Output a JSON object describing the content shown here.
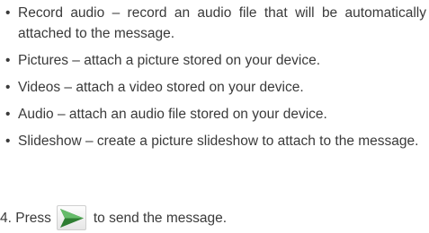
{
  "bullet_symbol": "•",
  "bullets": [
    {
      "text": "Record audio – record an audio file that will be automatically attached to the message."
    },
    {
      "text": "Pictures – attach a picture stored on your device."
    },
    {
      "text": "Videos – attach a video stored on your device."
    },
    {
      "text": "Audio – attach an audio file stored on your device."
    },
    {
      "text": "Slideshow – create a picture slideshow to attach to the message."
    }
  ],
  "step": {
    "prefix": "4. Press",
    "icon": "send-arrow-icon",
    "suffix": "to send the message."
  },
  "colors": {
    "text": "#3a3a3a",
    "icon_green": "#2e7d32"
  }
}
